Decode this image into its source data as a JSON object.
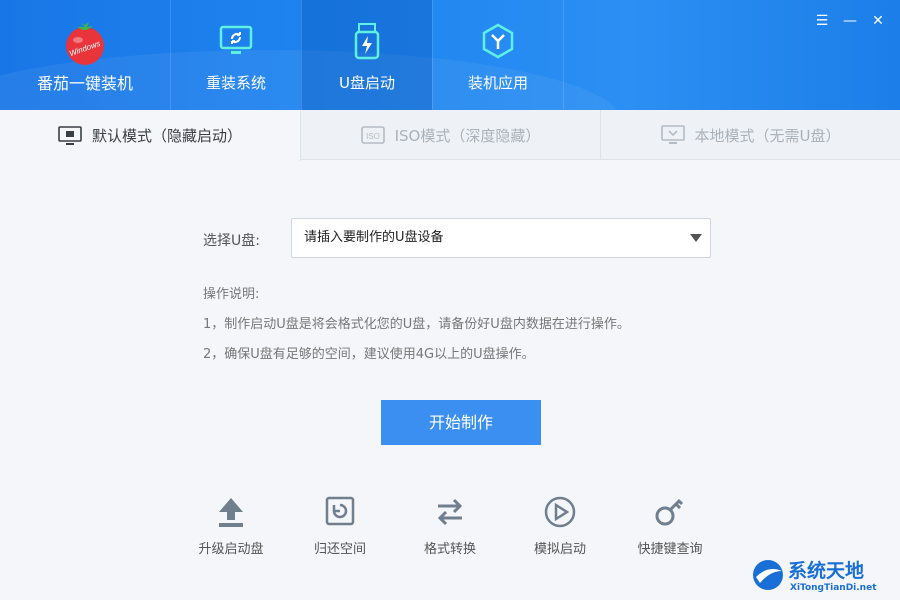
{
  "app": {
    "title": "番茄一键装机",
    "logo_text": "Windows"
  },
  "window_controls": {
    "menu": "☰",
    "minimize": "—",
    "close": "✕"
  },
  "nav": [
    {
      "label": "重装系统",
      "icon": "monitor-sync-icon"
    },
    {
      "label": "U盘启动",
      "icon": "usb-drive-icon"
    },
    {
      "label": "装机应用",
      "icon": "apps-hexagon-icon"
    }
  ],
  "tabs": [
    {
      "label": "默认模式（隐藏启动）",
      "icon": "monitor-icon",
      "active": true
    },
    {
      "label": "ISO模式（深度隐藏）",
      "icon": "iso-icon",
      "active": false
    },
    {
      "label": "本地模式（无需U盘）",
      "icon": "monitor-icon",
      "active": false
    }
  ],
  "form": {
    "select_label": "选择U盘:",
    "select_value": "请插入要制作的U盘设备"
  },
  "notes": {
    "title": "操作说明:",
    "line1": "1，制作启动U盘是将会格式化您的U盘，请备份好U盘内数据在进行操作。",
    "line2": "2，确保U盘有足够的空间，建议使用4G以上的U盘操作。"
  },
  "start_button": "开始制作",
  "tools": [
    {
      "label": "升级启动盘",
      "icon": "upload-arrow-icon"
    },
    {
      "label": "归还空间",
      "icon": "restore-icon"
    },
    {
      "label": "格式转换",
      "icon": "swap-arrows-icon"
    },
    {
      "label": "模拟启动",
      "icon": "play-circle-icon"
    },
    {
      "label": "快捷键查询",
      "icon": "key-icon"
    }
  ],
  "watermark": {
    "text": "系统天地",
    "sub": "XiTongTianDi.net"
  },
  "colors": {
    "header": "#1f86f0",
    "accent": "#3a8ff0",
    "icon_gray": "#6f7f8e"
  }
}
